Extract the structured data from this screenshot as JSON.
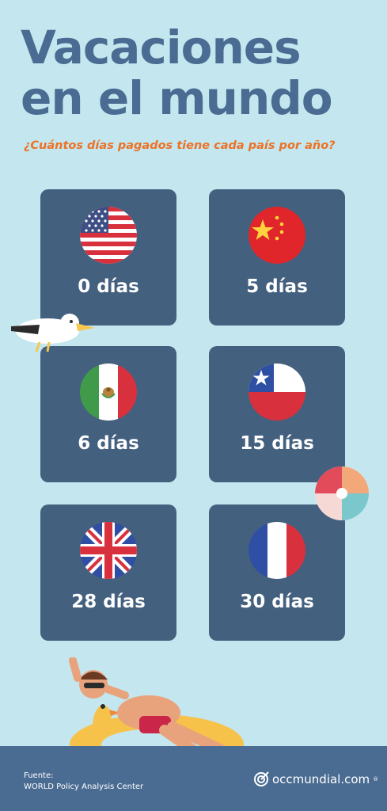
{
  "header": {
    "title_line1": "Vacaciones",
    "title_line2": "en el mundo",
    "subtitle": "¿Cuántos días pagados tiene cada país por año?"
  },
  "countries": [
    {
      "flag": "usa-flag-icon",
      "days_label": "0 días",
      "days": 0
    },
    {
      "flag": "china-flag-icon",
      "days_label": "5 días",
      "days": 5
    },
    {
      "flag": "mexico-flag-icon",
      "days_label": "6 días",
      "days": 6
    },
    {
      "flag": "chile-flag-icon",
      "days_label": "15 días",
      "days": 15
    },
    {
      "flag": "uk-flag-icon",
      "days_label": "28 días",
      "days": 28
    },
    {
      "flag": "france-flag-icon",
      "days_label": "30 días",
      "days": 30
    }
  ],
  "footer": {
    "source_label": "Fuente:",
    "source_value": "WORLD Policy Analysis Center",
    "brand": "occmundial.com",
    "brand_mark": "®"
  },
  "colors": {
    "background": "#c4e6ee",
    "title": "#4a6c92",
    "subtitle": "#ec7226",
    "card": "#44607f",
    "footer": "#4a6c92"
  },
  "decorations": [
    "seagull-illustration",
    "beach-ball-illustration",
    "man-on-swim-ring-illustration"
  ]
}
